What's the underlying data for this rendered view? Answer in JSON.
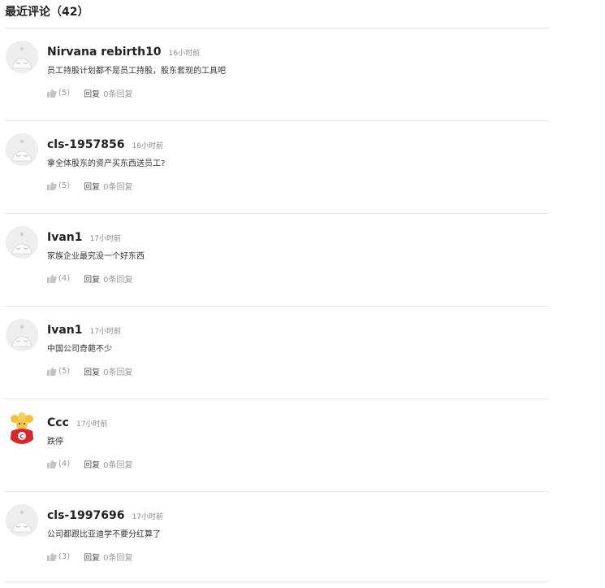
{
  "header": {
    "title": "最近评论（42）"
  },
  "comments": [
    {
      "username": "Nirvana rebirth10",
      "time": "16小时前",
      "text": "员工持股计划都不是员工持股，股东套现的工具吧",
      "likes": "(5)",
      "reply": "回复",
      "reply_count": "0条回复",
      "avatar": "default-avatar-icon"
    },
    {
      "username": "cls-1957856",
      "time": "16小时前",
      "text": "拿全体股东的资产买东西送员工?",
      "likes": "(5)",
      "reply": "回复",
      "reply_count": "0条回复",
      "avatar": "default-avatar-icon"
    },
    {
      "username": "Ivan1",
      "time": "17小时前",
      "text": "家族企业最究没一个好东西",
      "likes": "(4)",
      "reply": "回复",
      "reply_count": "0条回复",
      "avatar": "default-avatar-icon"
    },
    {
      "username": "Ivan1",
      "time": "17小时前",
      "text": "中国公司奇葩不少",
      "likes": "(5)",
      "reply": "回复",
      "reply_count": "0条回复",
      "avatar": "default-avatar-icon"
    },
    {
      "username": "Ccc",
      "time": "17小时前",
      "text": "跌停",
      "likes": "(4)",
      "reply": "回复",
      "reply_count": "0条回复",
      "avatar": "mascot-avatar-icon"
    },
    {
      "username": "cls-1997696",
      "time": "17小时前",
      "text": "公司都跟比亚迪学不要分红算了",
      "likes": "(3)",
      "reply": "回复",
      "reply_count": "0条回复",
      "avatar": "default-avatar-icon"
    }
  ],
  "colors": {
    "meta": "#8a8a8a",
    "divider": "#e6e6e6",
    "text": "#222222"
  }
}
